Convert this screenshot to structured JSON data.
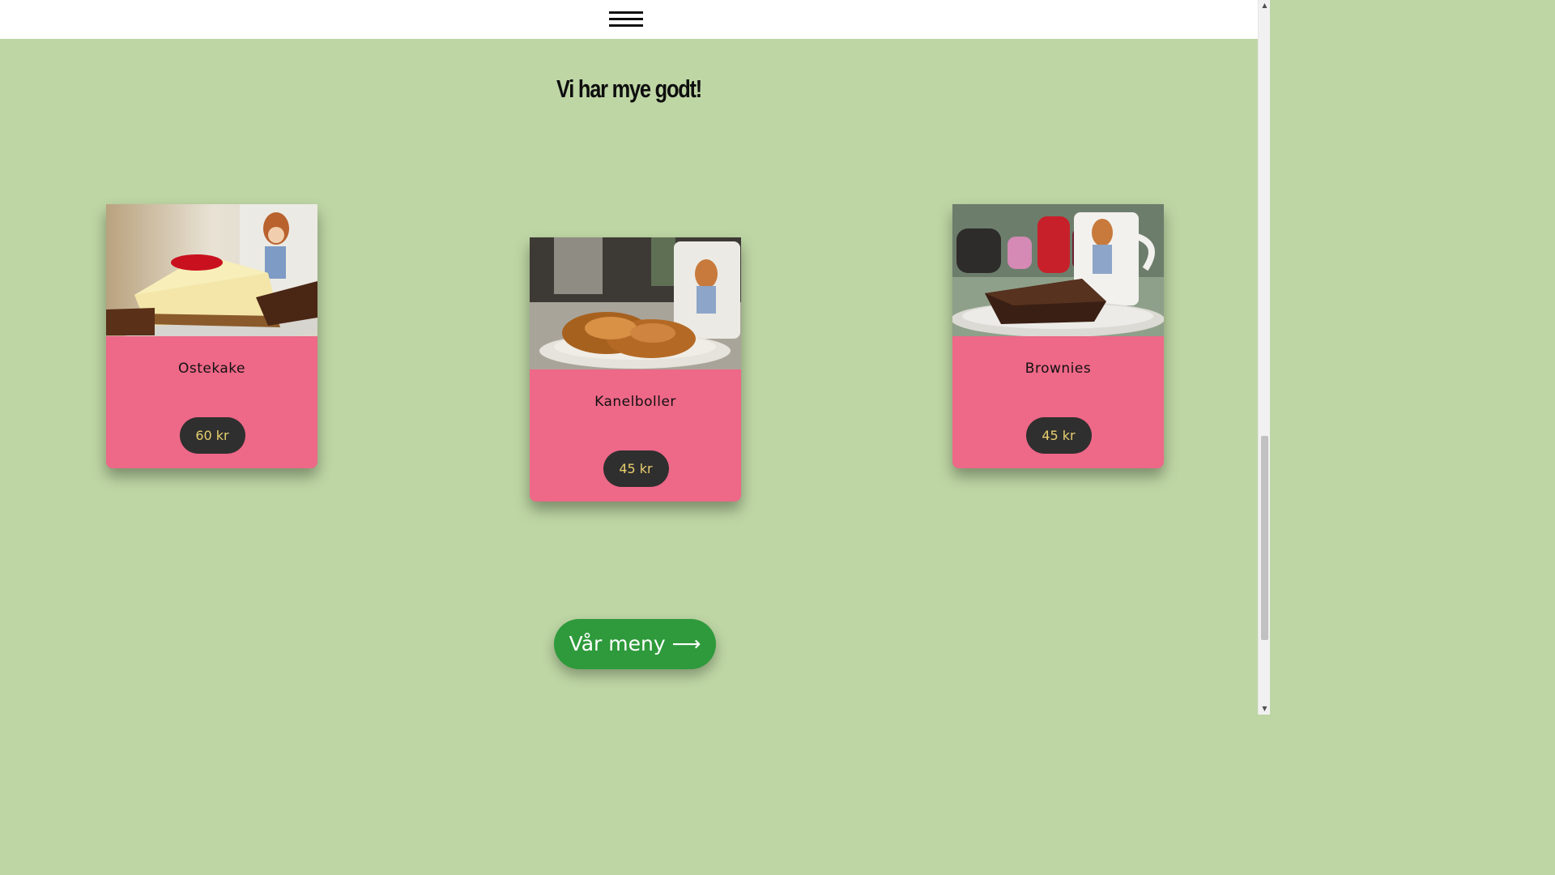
{
  "header": {
    "menu_icon": "hamburger-menu-icon"
  },
  "section": {
    "title": "Vi har mye godt!"
  },
  "products": [
    {
      "name": "Ostekake",
      "price": "60 kr"
    },
    {
      "name": "Kanelboller",
      "price": "45 kr"
    },
    {
      "name": "Brownies",
      "price": "45 kr"
    }
  ],
  "cta": {
    "label": "Vår meny ⟶"
  },
  "colors": {
    "background": "#bed6a4",
    "card": "#ee6888",
    "price_badge": "#2f2f2f",
    "price_text": "#e8cf6e",
    "cta": "#2e9a3b"
  }
}
